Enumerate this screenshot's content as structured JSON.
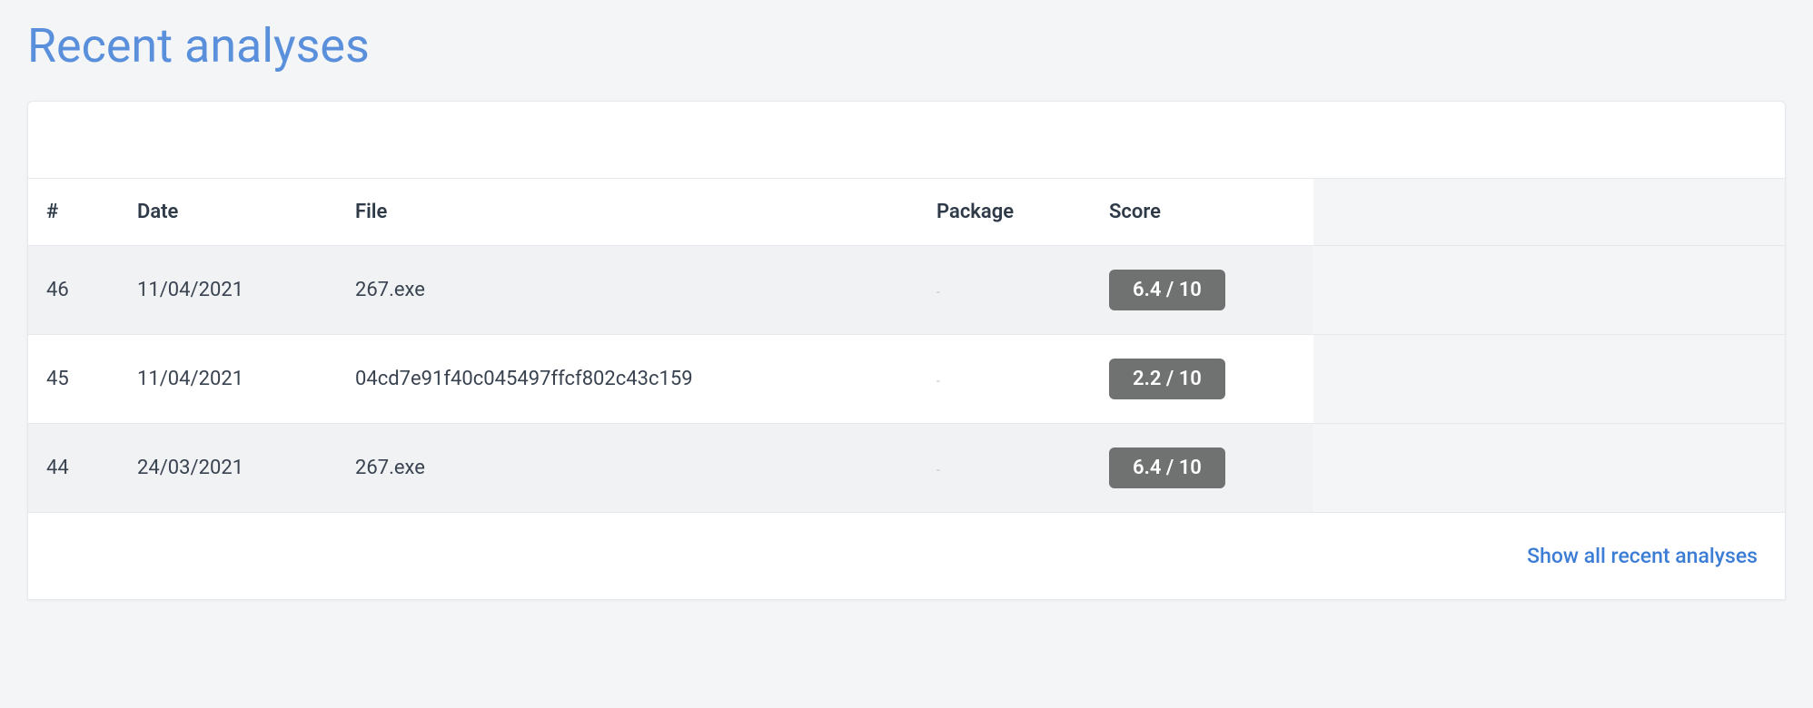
{
  "page": {
    "title": "Recent analyses"
  },
  "table": {
    "headers": {
      "id": "#",
      "date": "Date",
      "file": "File",
      "package": "Package",
      "score": "Score"
    },
    "rows": [
      {
        "id": "46",
        "date": "11/04/2021",
        "file": "267.exe",
        "package": "-",
        "score": "6.4 / 10"
      },
      {
        "id": "45",
        "date": "11/04/2021",
        "file": "04cd7e91f40c045497ffcf802c43c159",
        "package": "-",
        "score": "2.2 / 10"
      },
      {
        "id": "44",
        "date": "24/03/2021",
        "file": "267.exe",
        "package": "-",
        "score": "6.4 / 10"
      }
    ]
  },
  "footer": {
    "show_all_label": "Show all recent analyses"
  }
}
